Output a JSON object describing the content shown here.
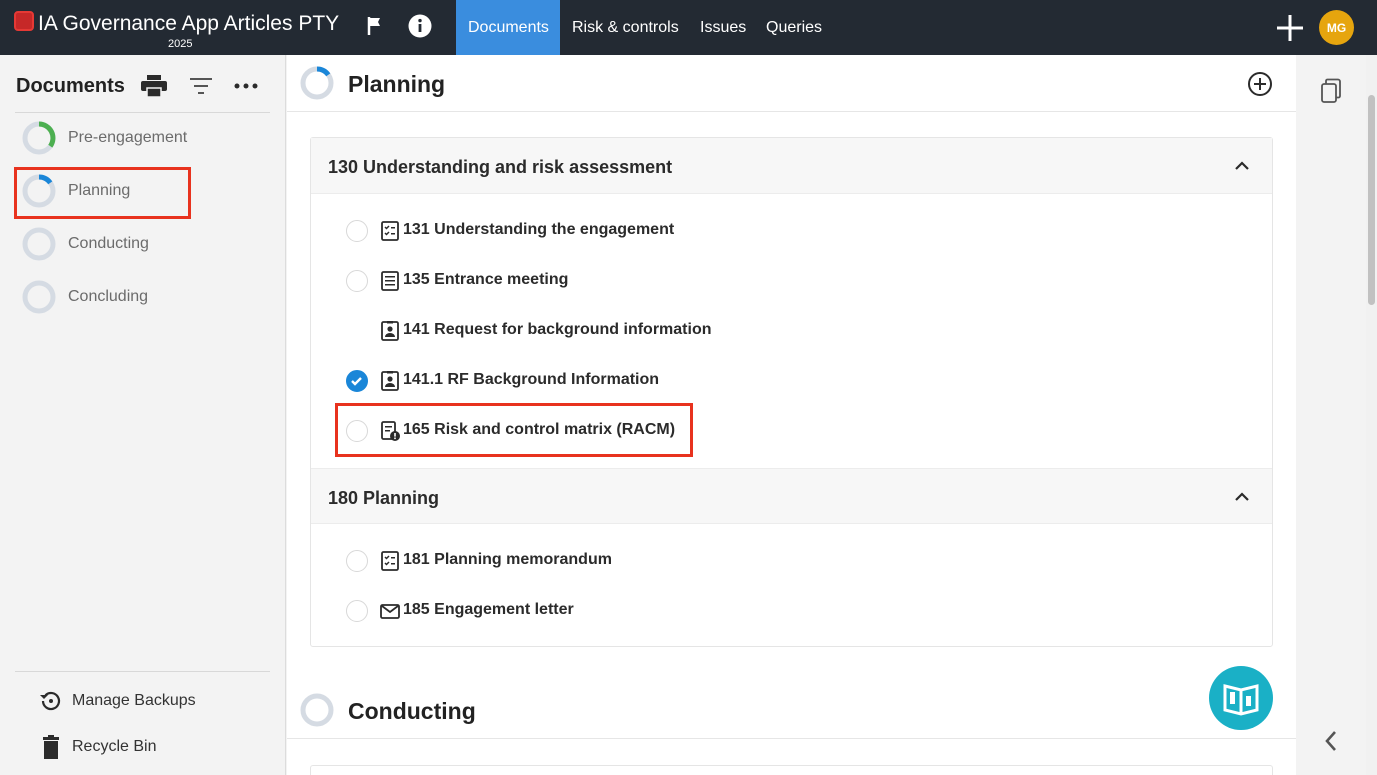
{
  "app": {
    "title": "IA Governance App Articles PTY",
    "year": "2025",
    "user_initials": "MG",
    "accent": "#3a8dde"
  },
  "nav": {
    "tabs": [
      {
        "label": "Documents",
        "active": true
      },
      {
        "label": "Risk & controls",
        "active": false
      },
      {
        "label": "Issues",
        "active": false
      },
      {
        "label": "Queries",
        "active": false
      }
    ]
  },
  "sidebar": {
    "title": "Documents",
    "phases": [
      {
        "label": "Pre-engagement",
        "progress": 0.4,
        "color": "#4caf50"
      },
      {
        "label": "Planning",
        "progress": 0.15,
        "color": "#1a86d8",
        "selected": true
      },
      {
        "label": "Conducting",
        "progress": 0,
        "color": "#1a86d8"
      },
      {
        "label": "Concluding",
        "progress": 0,
        "color": "#1a86d8"
      }
    ],
    "bottom": {
      "manage_backups": "Manage Backups",
      "recycle_bin": "Recycle Bin"
    }
  },
  "main": {
    "section_title": "Planning",
    "section_progress": 0.15,
    "groups": [
      {
        "title": "130 Understanding and risk assessment",
        "items": [
          {
            "label": "131 Understanding the engagement",
            "icon": "checklist-doc-icon",
            "status": "open"
          },
          {
            "label": "135 Entrance meeting",
            "icon": "text-doc-icon",
            "status": "open"
          },
          {
            "label": "141 Request for background information",
            "icon": "contact-doc-icon",
            "status": "none"
          },
          {
            "label": "141.1 RF Background Information",
            "icon": "contact-doc-icon",
            "status": "done"
          },
          {
            "label": "165 Risk and control matrix (RACM)",
            "icon": "doc-alert-icon",
            "status": "open"
          }
        ]
      },
      {
        "title": "180 Planning",
        "items": [
          {
            "label": "181 Planning memorandum",
            "icon": "checklist-doc-icon",
            "status": "open"
          },
          {
            "label": "185 Engagement letter",
            "icon": "envelope-icon",
            "status": "open"
          }
        ]
      }
    ],
    "next_section_title": "Conducting"
  }
}
